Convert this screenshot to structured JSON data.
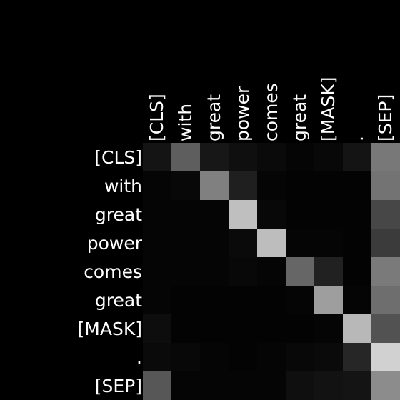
{
  "chart_data": {
    "type": "heatmap",
    "title": "",
    "xlabel": "",
    "ylabel": "",
    "x_tokens": [
      "[CLS]",
      "with",
      "great",
      "power",
      "comes",
      "great",
      "[MASK]",
      ".",
      "[SEP]"
    ],
    "y_tokens": [
      "[CLS]",
      "with",
      "great",
      "power",
      "comes",
      "great",
      "[MASK]",
      ".",
      "[SEP]"
    ],
    "value_range": [
      0,
      1
    ],
    "colormap": "grayscale",
    "values": [
      [
        0.08,
        0.37,
        0.09,
        0.06,
        0.04,
        0.02,
        0.03,
        0.08,
        0.47
      ],
      [
        0.02,
        0.03,
        0.5,
        0.12,
        0.02,
        0.01,
        0.01,
        0.01,
        0.45
      ],
      [
        0.02,
        0.02,
        0.02,
        0.75,
        0.03,
        0.01,
        0.01,
        0.01,
        0.28
      ],
      [
        0.02,
        0.02,
        0.02,
        0.04,
        0.74,
        0.02,
        0.02,
        0.01,
        0.23
      ],
      [
        0.02,
        0.02,
        0.02,
        0.03,
        0.02,
        0.4,
        0.13,
        0.01,
        0.48
      ],
      [
        0.02,
        0.01,
        0.01,
        0.01,
        0.01,
        0.02,
        0.62,
        0.02,
        0.43
      ],
      [
        0.05,
        0.01,
        0.01,
        0.01,
        0.01,
        0.01,
        0.02,
        0.72,
        0.32
      ],
      [
        0.04,
        0.03,
        0.02,
        0.01,
        0.02,
        0.03,
        0.04,
        0.15,
        0.82
      ],
      [
        0.34,
        0.02,
        0.02,
        0.02,
        0.02,
        0.06,
        0.07,
        0.08,
        0.55
      ]
    ]
  }
}
